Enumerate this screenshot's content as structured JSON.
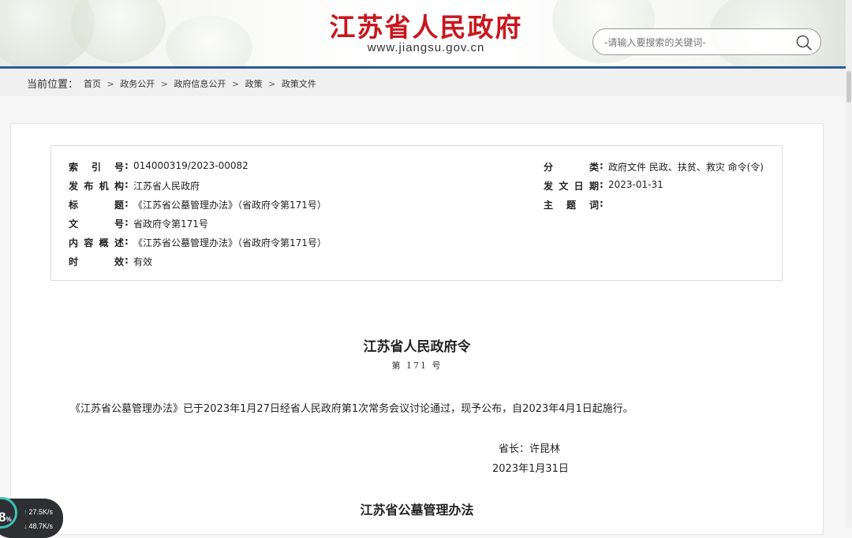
{
  "header": {
    "site_title": "江苏省人民政府",
    "site_url": "www.jiangsu.gov.cn",
    "search_placeholder": "-请输入要搜索的关键词-"
  },
  "breadcrumb": {
    "label": "当前位置：",
    "items": [
      "首页",
      "政务公开",
      "政府信息公开",
      "政策",
      "政策文件"
    ],
    "separator": ">"
  },
  "meta": {
    "index_no": {
      "key": "索引号",
      "value": "014000319/2023-00082"
    },
    "publisher": {
      "key": "发布机构",
      "value": "江苏省人民政府"
    },
    "title": {
      "key": "标题",
      "value": "《江苏省公墓管理办法》（省政府令第171号）"
    },
    "doc_no": {
      "key": "文号",
      "value": "省政府令第171号"
    },
    "summary": {
      "key": "内容概述",
      "value": "《江苏省公墓管理办法》（省政府令第171号）"
    },
    "validity": {
      "key": "时效",
      "value": "有效"
    },
    "category": {
      "key": "分类",
      "value": "政府文件 民政、扶贫、救灾 命令(令)"
    },
    "issue_date": {
      "key": "发文日期",
      "value": "2023-01-31"
    },
    "subject": {
      "key": "主题词",
      "value": ""
    }
  },
  "document": {
    "title": "江苏省人民政府令",
    "number": "第 171 号",
    "body": "《江苏省公墓管理办法》已于2023年1月27日经省人民政府第1次常务会议讨论通过，现予公布，自2023年4月1日起施行。",
    "signature": "省长：许昆林",
    "date": "2023年1月31日",
    "subtitle": "江苏省公墓管理办法"
  },
  "speed_widget": {
    "percent": "8",
    "percent_unit": "%",
    "upload": "27.5",
    "upload_unit": "K/s",
    "download": "48.7",
    "download_unit": "K/s"
  },
  "colors": {
    "brand_red": "#c8161d",
    "rule_blue": "#2a5a9b",
    "widget_teal": "#3bc3b8"
  }
}
